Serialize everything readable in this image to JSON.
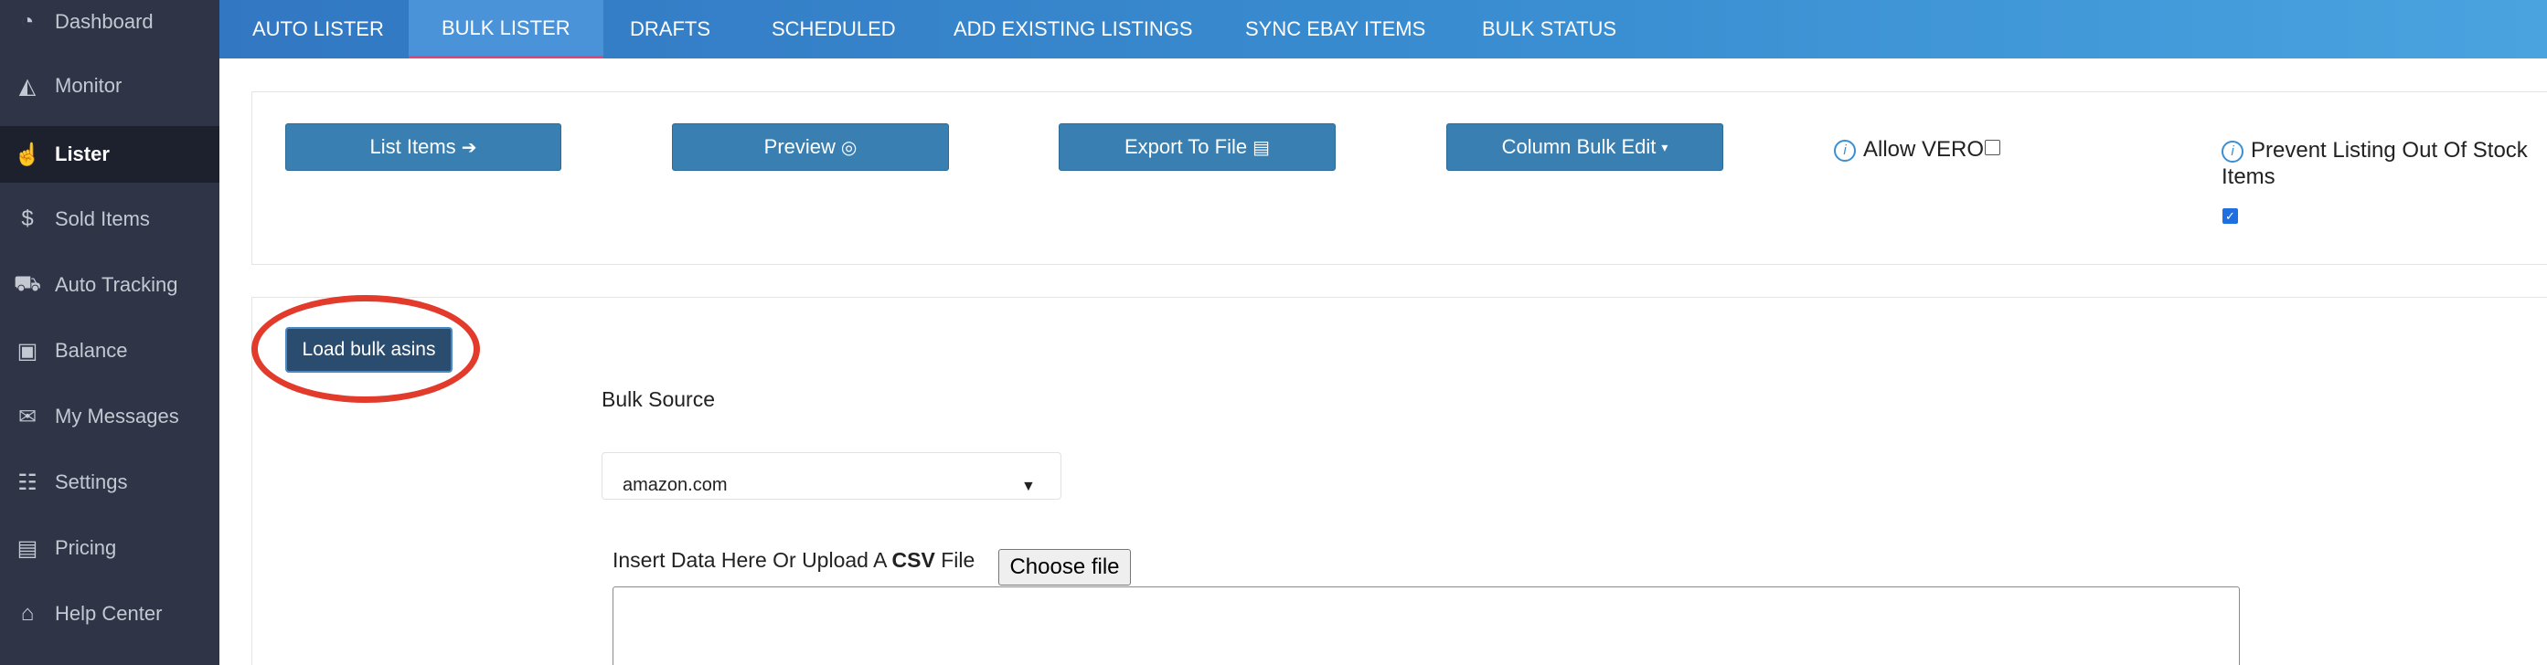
{
  "sidebar": {
    "items": [
      {
        "label": "Dashboard",
        "icon": "dashboard-icon",
        "glyph": "◔",
        "active": false
      },
      {
        "label": "Monitor",
        "icon": "chart-icon",
        "glyph": "◭",
        "active": false
      },
      {
        "label": "Lister",
        "icon": "hand-icon",
        "glyph": "☝",
        "active": true
      },
      {
        "label": "Sold Items",
        "icon": "dollar-icon",
        "glyph": "$",
        "active": false
      },
      {
        "label": "Auto Tracking",
        "icon": "truck-icon",
        "glyph": "⛟",
        "active": false
      },
      {
        "label": "Balance",
        "icon": "money-icon",
        "glyph": "▣",
        "active": false
      },
      {
        "label": "My Messages",
        "icon": "envelope-icon",
        "glyph": "✉",
        "active": false
      },
      {
        "label": "Settings",
        "icon": "sliders-icon",
        "glyph": "☷",
        "active": false
      },
      {
        "label": "Pricing",
        "icon": "wallet-icon",
        "glyph": "▤",
        "active": false
      },
      {
        "label": "Help Center",
        "icon": "graduation-cap-icon",
        "glyph": "⌂",
        "active": false
      }
    ]
  },
  "topnav": {
    "tabs": [
      {
        "label": "AUTO LISTER",
        "active": false
      },
      {
        "label": "BULK LISTER",
        "active": true
      },
      {
        "label": "DRAFTS",
        "active": false
      },
      {
        "label": "SCHEDULED",
        "active": false
      },
      {
        "label": "ADD EXISTING LISTINGS",
        "active": false
      },
      {
        "label": "SYNC EBAY ITEMS",
        "active": false
      },
      {
        "label": "BULK STATUS",
        "active": false
      }
    ]
  },
  "toolbar": {
    "list_items": "List Items",
    "preview": "Preview",
    "export_to_file": "Export To File",
    "column_bulk_edit": "Column Bulk Edit",
    "allow_vero": "Allow VERO",
    "allow_vero_checked": false,
    "prevent_oos": "Prevent Listing Out Of Stock Items",
    "prevent_oos_checked": true
  },
  "bulk": {
    "load_button": "Load bulk asins",
    "source_label": "Bulk Source",
    "source_value": "amazon.com",
    "insert_label_prefix": "Insert Data Here Or Upload A ",
    "insert_label_bold": "CSV",
    "insert_label_suffix": " File",
    "choose_file": "Choose file",
    "textarea_value": ""
  },
  "colors": {
    "sidebar_bg": "#2f3446",
    "sidebar_active_bg": "#1d212d",
    "nav_gradient_start": "#3277c2",
    "nav_gradient_end": "#4aa3df",
    "button_bg": "#3a7fb1",
    "active_tab_underline": "#e0457c",
    "annotation_ring": "#e23a2b"
  }
}
